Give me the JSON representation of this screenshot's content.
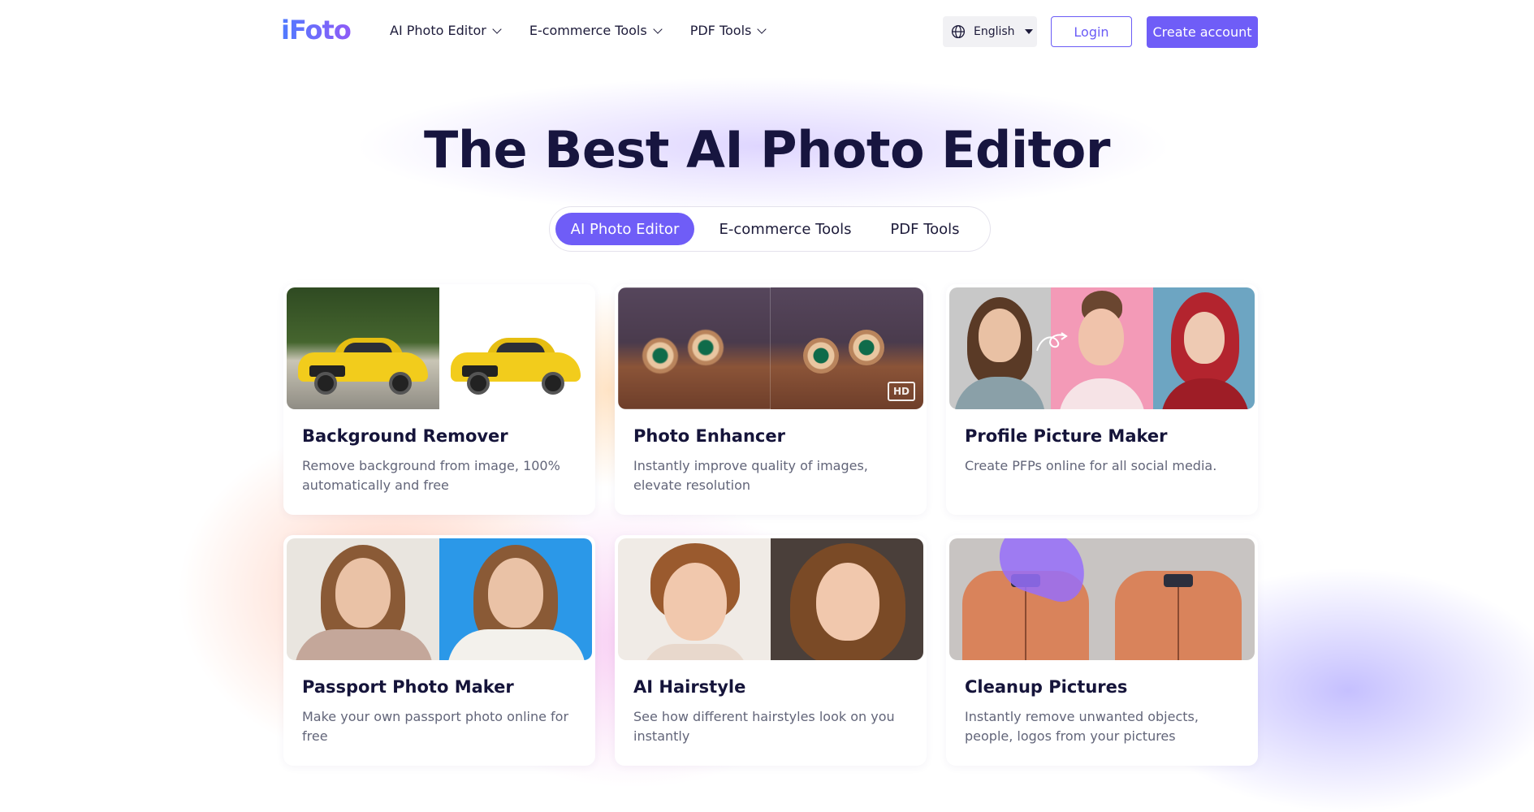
{
  "header": {
    "logo": "iFoto",
    "nav": [
      {
        "label": "AI Photo Editor"
      },
      {
        "label": "E-commerce Tools"
      },
      {
        "label": "PDF Tools"
      }
    ],
    "language": "English",
    "login_label": "Login",
    "create_account_label": "Create account"
  },
  "hero": {
    "title": "The Best AI Photo Editor",
    "tabs": [
      {
        "label": "AI Photo Editor",
        "active": true
      },
      {
        "label": "E-commerce Tools",
        "active": false
      },
      {
        "label": "PDF Tools",
        "active": false
      }
    ]
  },
  "tools": [
    {
      "title": "Background Remover",
      "description": "Remove background from image, 100% automatically and free"
    },
    {
      "title": "Photo Enhancer",
      "description": "Instantly improve quality of images, elevate resolution",
      "badge": "HD"
    },
    {
      "title": "Profile Picture Maker",
      "description": "Create PFPs online for all social media."
    },
    {
      "title": "Passport Photo Maker",
      "description": "Make your own passport photo online for free"
    },
    {
      "title": "AI Hairstyle",
      "description": "See how different hairstyles look on you instantly"
    },
    {
      "title": "Cleanup Pictures",
      "description": "Instantly remove unwanted objects, people, logos from your pictures"
    }
  ],
  "colors": {
    "accent": "#6f5df7",
    "title": "#17153f",
    "body_text": "#626579"
  },
  "icons": {
    "nav_chevron": "chevron-down-icon",
    "language": "globe-icon",
    "language_caret": "caret-down-icon"
  }
}
